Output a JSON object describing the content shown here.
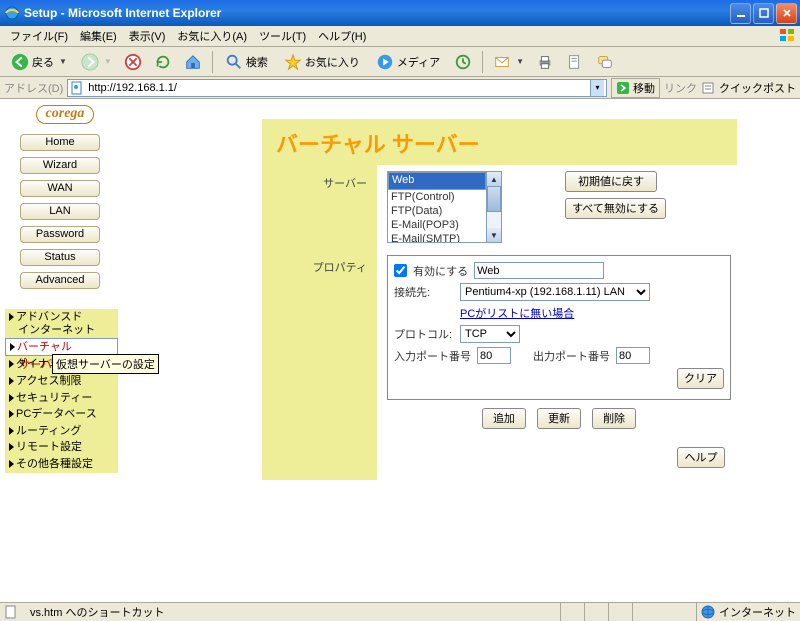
{
  "window": {
    "title": "Setup - Microsoft Internet Explorer"
  },
  "menu": {
    "file": "ファイル(F)",
    "edit": "編集(E)",
    "view": "表示(V)",
    "fav": "お気に入り(A)",
    "tools": "ツール(T)",
    "help": "ヘルプ(H)"
  },
  "toolbar": {
    "back": "戻る",
    "search": "検索",
    "fav": "お気に入り",
    "media": "メディア"
  },
  "address": {
    "label": "アドレス(D)",
    "url": "http://192.168.1.1/",
    "go": "移動",
    "links": "リンク",
    "quickpost": "クイックポスト"
  },
  "logo": "corega",
  "nav": [
    "Home",
    "Wizard",
    "WAN",
    "LAN",
    "Password",
    "Status",
    "Advanced"
  ],
  "submenu": {
    "items": [
      "アドバンスド\nインターネット",
      "バーチャル\nサーバ",
      "ダイナミックDNS",
      "アクセス制限",
      "セキュリティー",
      "PCデータベース",
      "ルーティング",
      "リモート設定",
      "その他各種設定"
    ],
    "selected": 1,
    "tooltip": "仮想サーバーの設定"
  },
  "page": {
    "title": "バーチャル サーバー",
    "server_lbl": "サーバー",
    "props_lbl": "プロパティ",
    "servers": [
      "Web",
      "FTP(Control)",
      "FTP(Data)",
      "E-Mail(POP3)",
      "E-Mail(SMTP)"
    ],
    "btn_reset": "初期値に戻す",
    "btn_disable_all": "すべて無効にする",
    "enable": "有効にする",
    "name_value": "Web",
    "conn_lbl": "接続先:",
    "conn_value": "Pentium4-xp (192.168.1.11) LAN",
    "pc_not_in_list": "PCがリストに無い場合",
    "proto_lbl": "プロトコル:",
    "proto_value": "TCP",
    "inport_lbl": "入力ポート番号",
    "inport_val": "80",
    "outport_lbl": "出力ポート番号",
    "outport_val": "80",
    "btn_clear": "クリア",
    "btn_add": "追加",
    "btn_update": "更新",
    "btn_delete": "削除",
    "btn_help": "ヘルプ"
  },
  "status": {
    "text": "vs.htm へのショートカット",
    "zone": "インターネット"
  }
}
